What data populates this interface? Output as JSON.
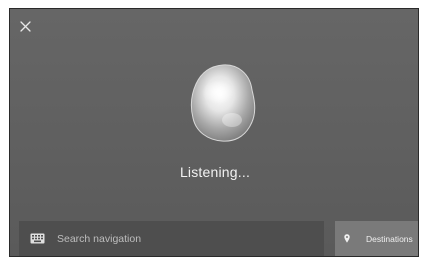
{
  "overlay": {
    "close_icon": "close-icon",
    "status_text": "Listening..."
  },
  "search": {
    "icon": "keyboard-icon",
    "placeholder": "Search navigation"
  },
  "destinations": {
    "icon": "location-pin-icon",
    "label": "Destinations"
  },
  "colors": {
    "background": "#606060",
    "search_bar": "#4e4e4e",
    "destinations_button": "#7a7a7a",
    "text": "#f2f2f2"
  }
}
